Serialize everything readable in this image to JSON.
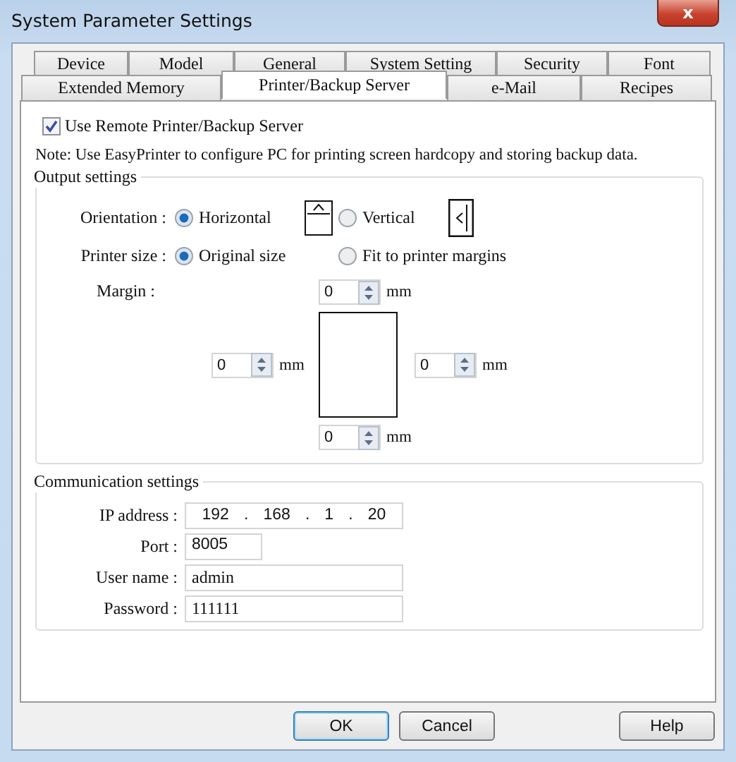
{
  "window": {
    "title": "System Parameter Settings",
    "close": "x"
  },
  "tab_rows": [
    {
      "tabs": [
        {
          "label": "Device",
          "selected": false
        },
        {
          "label": "Model",
          "selected": false
        },
        {
          "label": "General",
          "selected": false
        },
        {
          "label": "System Setting",
          "selected": false
        },
        {
          "label": "Security",
          "selected": false
        },
        {
          "label": "Font",
          "selected": false
        }
      ]
    },
    {
      "tabs": [
        {
          "label": "Extended Memory",
          "selected": false
        },
        {
          "label": "Printer/Backup Server",
          "selected": true
        },
        {
          "label": "e-Mail",
          "selected": false
        },
        {
          "label": "Recipes",
          "selected": false
        }
      ]
    }
  ],
  "use_remote": {
    "label": "Use Remote Printer/Backup Server",
    "checked": true
  },
  "note": "Note: Use EasyPrinter to configure PC for printing screen hardcopy and storing backup data.",
  "output_settings": {
    "title": "Output settings",
    "orientation": {
      "label": "Orientation :",
      "options": [
        {
          "label": "Horizontal",
          "selected": true,
          "kind": "landscape"
        },
        {
          "label": "Vertical",
          "selected": false,
          "kind": "portrait"
        }
      ]
    },
    "printer_size": {
      "label": "Printer size :",
      "options": [
        {
          "label": "Original size",
          "selected": true
        },
        {
          "label": "Fit to printer margins",
          "selected": false
        }
      ]
    },
    "margin": {
      "label": "Margin :",
      "top": {
        "value": "0",
        "unit": "mm"
      },
      "left": {
        "value": "0",
        "unit": "mm"
      },
      "right": {
        "value": "0",
        "unit": "mm"
      },
      "bottom": {
        "value": "0",
        "unit": "mm"
      }
    }
  },
  "communication_settings": {
    "title": "Communication settings",
    "ip_address": {
      "label": "IP address :",
      "octets": [
        "192",
        "168",
        "1",
        "20"
      ],
      "separator": "."
    },
    "port": {
      "label": "Port :",
      "value": "8005"
    },
    "user_name": {
      "label": "User name :",
      "value": "admin"
    },
    "password": {
      "label": "Password :",
      "value": "111111"
    }
  },
  "buttons": [
    {
      "label": "OK",
      "kind": "default"
    },
    {
      "label": "Cancel",
      "kind": "normal"
    },
    {
      "label": "Help",
      "kind": "help"
    }
  ]
}
